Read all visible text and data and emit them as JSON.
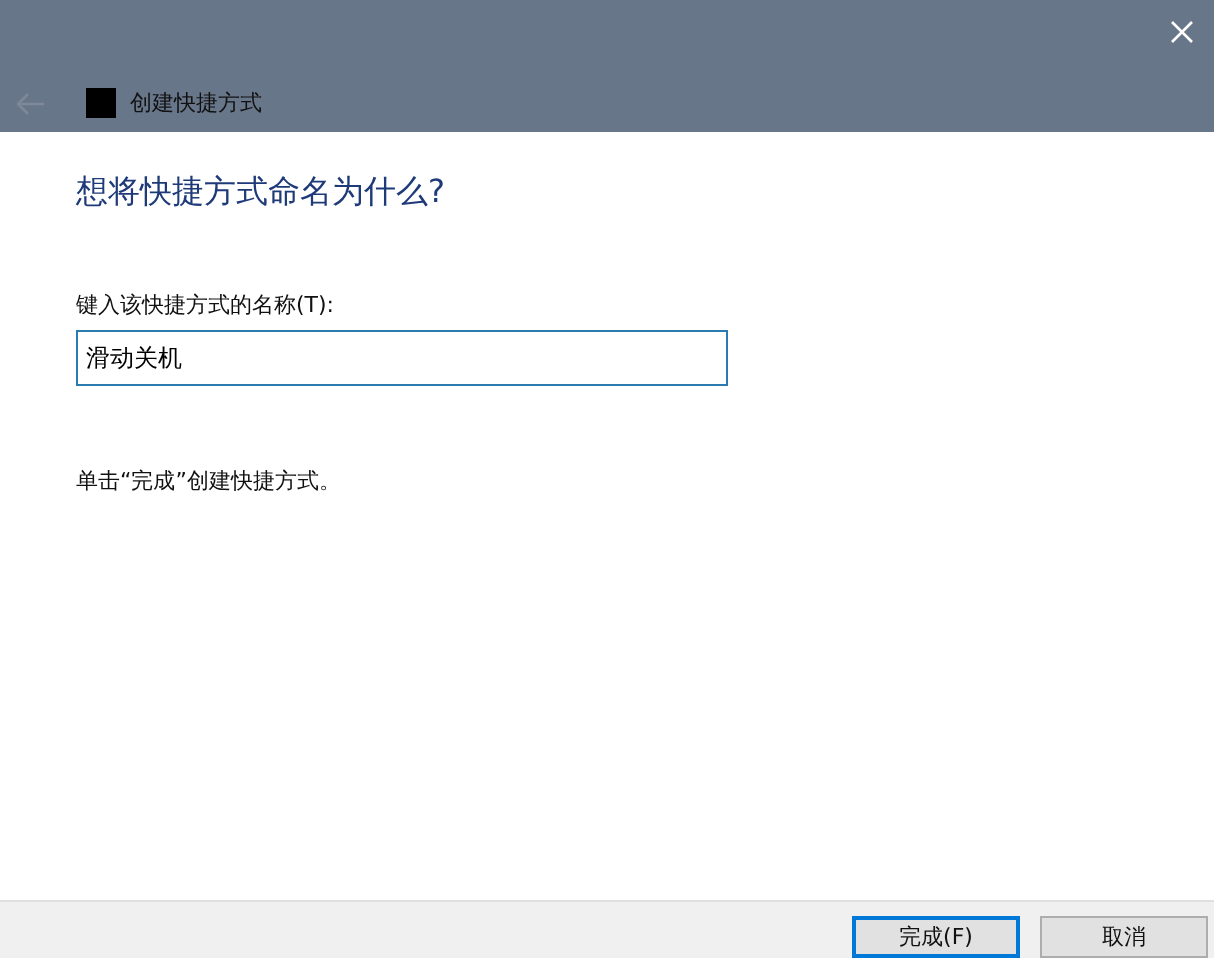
{
  "window": {
    "title": "创建快捷方式",
    "back_disabled": true
  },
  "heading": "想将快捷方式命名为什么?",
  "name_field": {
    "label": "键入该快捷方式的名称(T):",
    "value": "滑动关机"
  },
  "hint": "单击“完成”创建快捷方式。",
  "buttons": [
    {
      "label": "完成(F)",
      "default": true
    },
    {
      "label": "取消",
      "default": false
    }
  ]
}
